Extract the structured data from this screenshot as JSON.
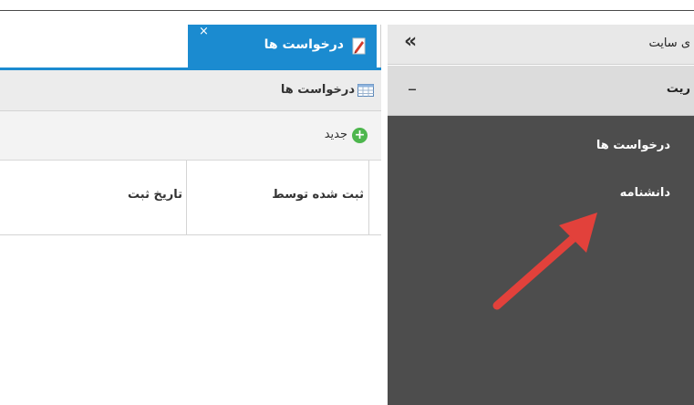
{
  "sidebar": {
    "title": "ی سایت",
    "section_title": "ریت",
    "collapse_glyph": "«",
    "minimize_glyph": "–",
    "items": [
      {
        "label": "درخواست ها"
      },
      {
        "label": "دانشنامه"
      }
    ]
  },
  "tabs": [
    {
      "label": "درخواست ها",
      "icon": "document-edit-icon",
      "close_glyph": "×",
      "active": true
    }
  ],
  "breadcrumb": {
    "label": "درخواست ها",
    "icon": "grid-icon"
  },
  "toolbar": {
    "new_label": "جدید",
    "new_icon": "add-circle-icon"
  },
  "grid": {
    "columns": [
      {
        "label": "ثبت شده توسط"
      },
      {
        "label": "تاریخ ثبت"
      }
    ]
  },
  "annotation": {
    "arrow_color": "#e2413b"
  },
  "colors": {
    "accent": "#1b8bd0",
    "sidebar_bg": "#4d4d4d",
    "add_green": "#4db64d"
  }
}
